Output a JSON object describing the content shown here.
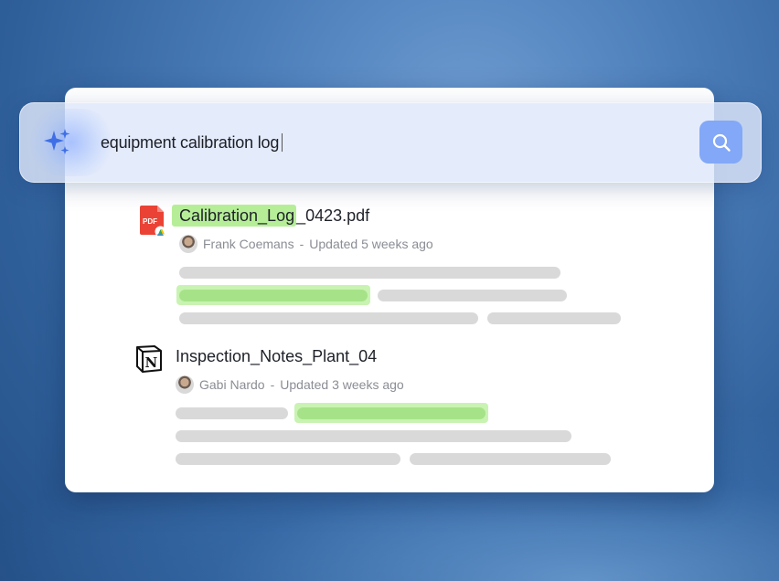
{
  "search": {
    "query": "equipment calibration log",
    "icon": "sparkle-icon",
    "button_icon": "search-icon",
    "accent_color": "#82a8f7"
  },
  "results": [
    {
      "source_icon": "pdf-icon",
      "title_highlight": "Calibration_Log",
      "title_rest": "_0423.pdf",
      "author": "Frank Coemans",
      "updated": "Updated 5 weeks ago"
    },
    {
      "source_icon": "notion-icon",
      "title": "Inspection_Notes_Plant_04",
      "author": "Gabi Nardo",
      "updated": "Updated 3 weeks ago"
    }
  ],
  "colors": {
    "highlight": "#b6ee98",
    "placeholder_bar": "#d9d9d9",
    "highlight_bar": "#a6e388"
  }
}
